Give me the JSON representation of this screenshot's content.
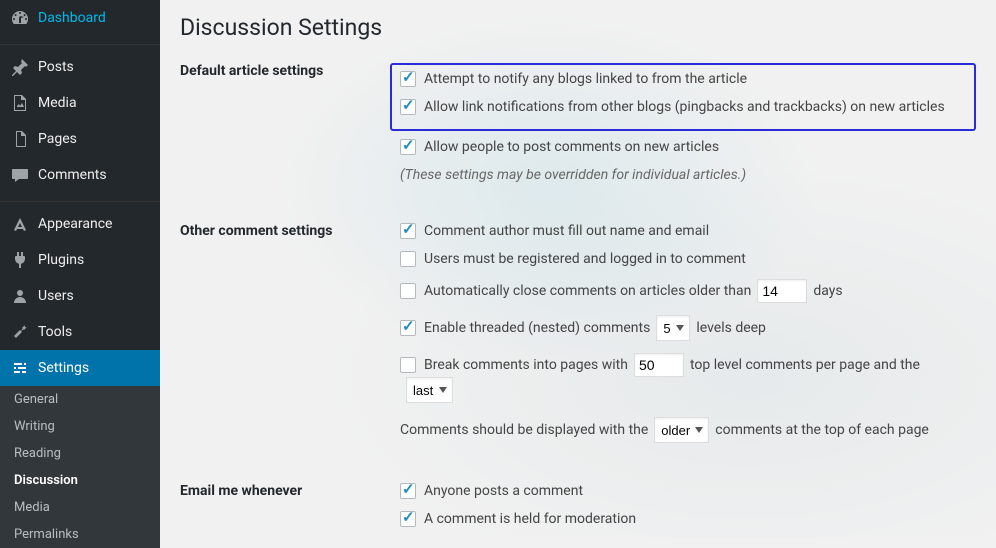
{
  "sidebar": {
    "items": [
      {
        "label": "Dashboard"
      },
      {
        "label": "Posts"
      },
      {
        "label": "Media"
      },
      {
        "label": "Pages"
      },
      {
        "label": "Comments"
      },
      {
        "label": "Appearance"
      },
      {
        "label": "Plugins"
      },
      {
        "label": "Users"
      },
      {
        "label": "Tools"
      },
      {
        "label": "Settings"
      }
    ],
    "sub": [
      {
        "label": "General"
      },
      {
        "label": "Writing"
      },
      {
        "label": "Reading"
      },
      {
        "label": "Discussion"
      },
      {
        "label": "Media"
      },
      {
        "label": "Permalinks"
      }
    ]
  },
  "page": {
    "title": "Discussion Settings"
  },
  "sections": {
    "default_article": {
      "heading": "Default article settings",
      "opt1": "Attempt to notify any blogs linked to from the article",
      "opt2": "Allow link notifications from other blogs (pingbacks and trackbacks) on new articles",
      "opt3": "Allow people to post comments on new articles",
      "note": "(These settings may be overridden for individual articles.)"
    },
    "other": {
      "heading": "Other comment settings",
      "opt1": "Comment author must fill out name and email",
      "opt2": "Users must be registered and logged in to comment",
      "opt3_pre": "Automatically close comments on articles older than",
      "opt3_days_val": "14",
      "opt3_post": "days",
      "opt4_pre": "Enable threaded (nested) comments",
      "opt4_levels_val": "5",
      "opt4_post": "levels deep",
      "opt5_pre": "Break comments into pages with",
      "opt5_val": "50",
      "opt5_mid": "top level comments per page and the",
      "opt5_sel": "last",
      "opt6_pre": "Comments should be displayed with the",
      "opt6_sel": "older",
      "opt6_post": "comments at the top of each page"
    },
    "email": {
      "heading": "Email me whenever",
      "opt1": "Anyone posts a comment",
      "opt2": "A comment is held for moderation"
    }
  }
}
